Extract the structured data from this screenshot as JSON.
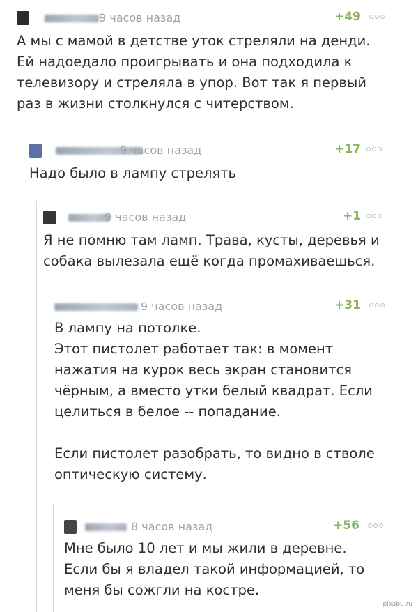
{
  "comments": [
    {
      "time": "9 часов назад",
      "rating": "+49",
      "paragraphs": [
        "А мы с мамой в детстве уток стреляли на денди.\nЕй надоедало проигрывать и она подходила к\nтелевизору и стреляла в упор. Вот так я первый\nраз в жизни столкнулся с читерством."
      ]
    },
    {
      "time": "9 часов назад",
      "rating": "+17",
      "paragraphs": [
        "Надо было в лампу стрелять"
      ]
    },
    {
      "time": "9 часов назад",
      "rating": "+1",
      "paragraphs": [
        "Я не помню там ламп. Трава, кусты, деревья и\nсобака вылезала ещё когда промахиваешься."
      ]
    },
    {
      "time": "9 часов назад",
      "rating": "+31",
      "paragraphs": [
        "В лампу на потолке.\nЭтот пистолет работает так: в момент\nнажатия на курок весь экран становится\nчёрным, а вместо утки белый квадрат. Если\nцелиться в белое -- попадание.",
        "Если пистолет разобрать, то видно в стволе\nоптическую систему."
      ]
    },
    {
      "time": "8 часов назад",
      "rating": "+56",
      "paragraphs": [
        "Мне было 10 лет и мы жили в деревне.\nЕсли бы я владел такой информацией, то\nменя бы сожгли на костре."
      ]
    }
  ],
  "watermark": "pikabu.ru",
  "colors": {
    "rating": "#8ab561",
    "time": "#a3a3a3",
    "text": "#2f2f2f",
    "thread_line": "#d8d8d8"
  }
}
